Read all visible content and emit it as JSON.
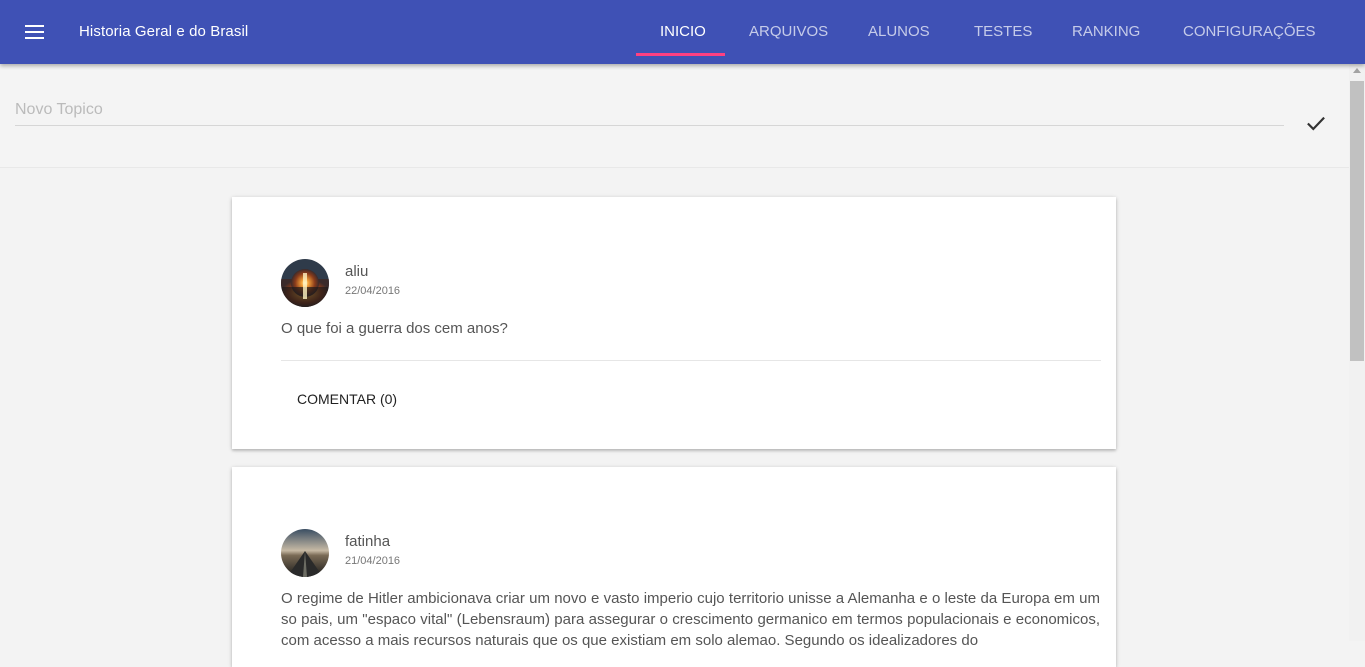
{
  "appbar": {
    "title": "Historia Geral e do Brasil",
    "tabs": [
      "INICIO",
      "ARQUIVOS",
      "ALUNOS",
      "TESTES",
      "RANKING",
      "CONFIGURAÇÕES"
    ],
    "active_tab": 0,
    "colors": {
      "primary": "#3f51b5",
      "accent": "#ff4081"
    }
  },
  "new_topic": {
    "placeholder": "Novo Topico",
    "value": ""
  },
  "posts": [
    {
      "author": "aliu",
      "date": "22/04/2016",
      "text": "O que foi a guerra dos cem anos?",
      "comment_label": "COMENTAR (0)"
    },
    {
      "author": "fatinha",
      "date": "21/04/2016",
      "text": "O regime de Hitler ambicionava criar um novo e vasto imperio cujo territorio unisse a Alemanha e o leste da Europa em um so pais, um \"espaco vital\" (Lebensraum) para assegurar o crescimento germanico em termos populacionais e economicos, com acesso a mais recursos naturais que os que existiam em solo alemao. Segundo os idealizadores do"
    }
  ]
}
